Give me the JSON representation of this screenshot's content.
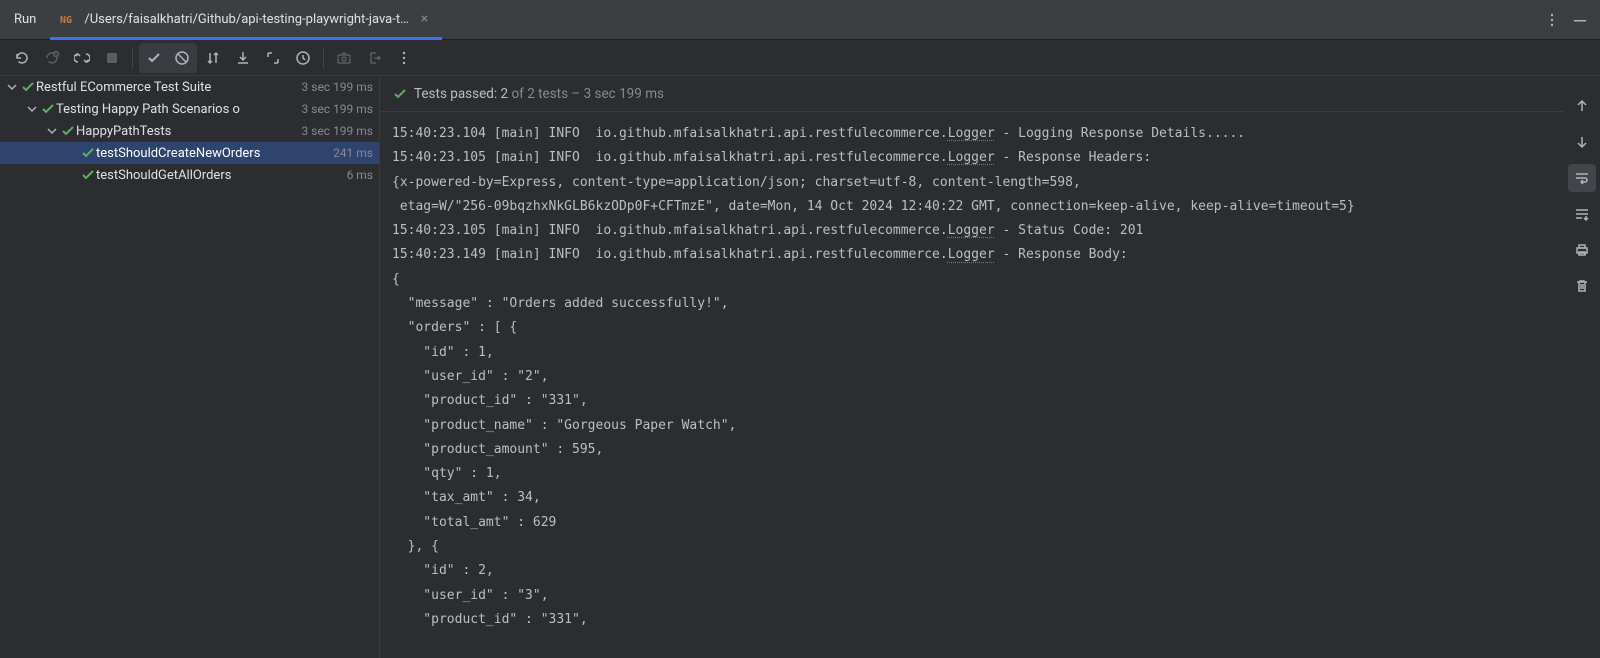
{
  "titlebar": {
    "run_label": "Run",
    "tab_title": "/Users/faisalkhatri/Github/api-testing-playwright-java-t…"
  },
  "summary": {
    "prefix": "Tests passed: ",
    "passed": "2",
    "rest": " of 2 tests – 3 sec 199 ms"
  },
  "tree": {
    "suite": {
      "label": "Restful ECommerce Test Suite",
      "time": "3 sec 199 ms"
    },
    "group1": {
      "label": "Testing Happy Path Scenarios o",
      "time": "3 sec 199 ms"
    },
    "group2": {
      "label": "HappyPathTests",
      "time": "3 sec 199 ms"
    },
    "test1": {
      "label": "testShouldCreateNewOrders",
      "time": "241 ms"
    },
    "test2": {
      "label": "testShouldGetAllOrders",
      "time": "6 ms"
    }
  },
  "console": {
    "lines": [
      {
        "t": "15:40:23.104 [main] INFO  io.github.mfaisalkhatri.api.restfulecommerce.",
        "u": "Logger",
        "r": " - Logging Response Details....."
      },
      {
        "t": "15:40:23.105 [main] INFO  io.github.mfaisalkhatri.api.restfulecommerce.",
        "u": "Logger",
        "r": " - Response Headers:"
      },
      {
        "t": "{x-powered-by=Express, content-type=application/json; charset=utf-8, content-length=598,"
      },
      {
        "t": " etag=W/\"256-09bqzhxNkGLB6kzODp0F+CFTmzE\", date=Mon, 14 Oct 2024 12:40:22 GMT, connection=keep-alive, keep-alive=timeout=5}"
      },
      {
        "t": "15:40:23.105 [main] INFO  io.github.mfaisalkhatri.api.restfulecommerce.",
        "u": "Logger",
        "r": " - Status Code: 201"
      },
      {
        "t": "15:40:23.149 [main] INFO  io.github.mfaisalkhatri.api.restfulecommerce.",
        "u": "Logger",
        "r": " - Response Body:"
      },
      {
        "t": "{"
      },
      {
        "t": "  \"message\" : \"Orders added successfully!\","
      },
      {
        "t": "  \"orders\" : [ {"
      },
      {
        "t": "    \"id\" : 1,"
      },
      {
        "t": "    \"user_id\" : \"2\","
      },
      {
        "t": "    \"product_id\" : \"331\","
      },
      {
        "t": "    \"product_name\" : \"Gorgeous Paper Watch\","
      },
      {
        "t": "    \"product_amount\" : 595,"
      },
      {
        "t": "    \"qty\" : 1,"
      },
      {
        "t": "    \"tax_amt\" : 34,"
      },
      {
        "t": "    \"total_amt\" : 629"
      },
      {
        "t": "  }, {"
      },
      {
        "t": "    \"id\" : 2,"
      },
      {
        "t": "    \"user_id\" : \"3\","
      },
      {
        "t": "    \"product_id\" : \"331\","
      }
    ]
  }
}
